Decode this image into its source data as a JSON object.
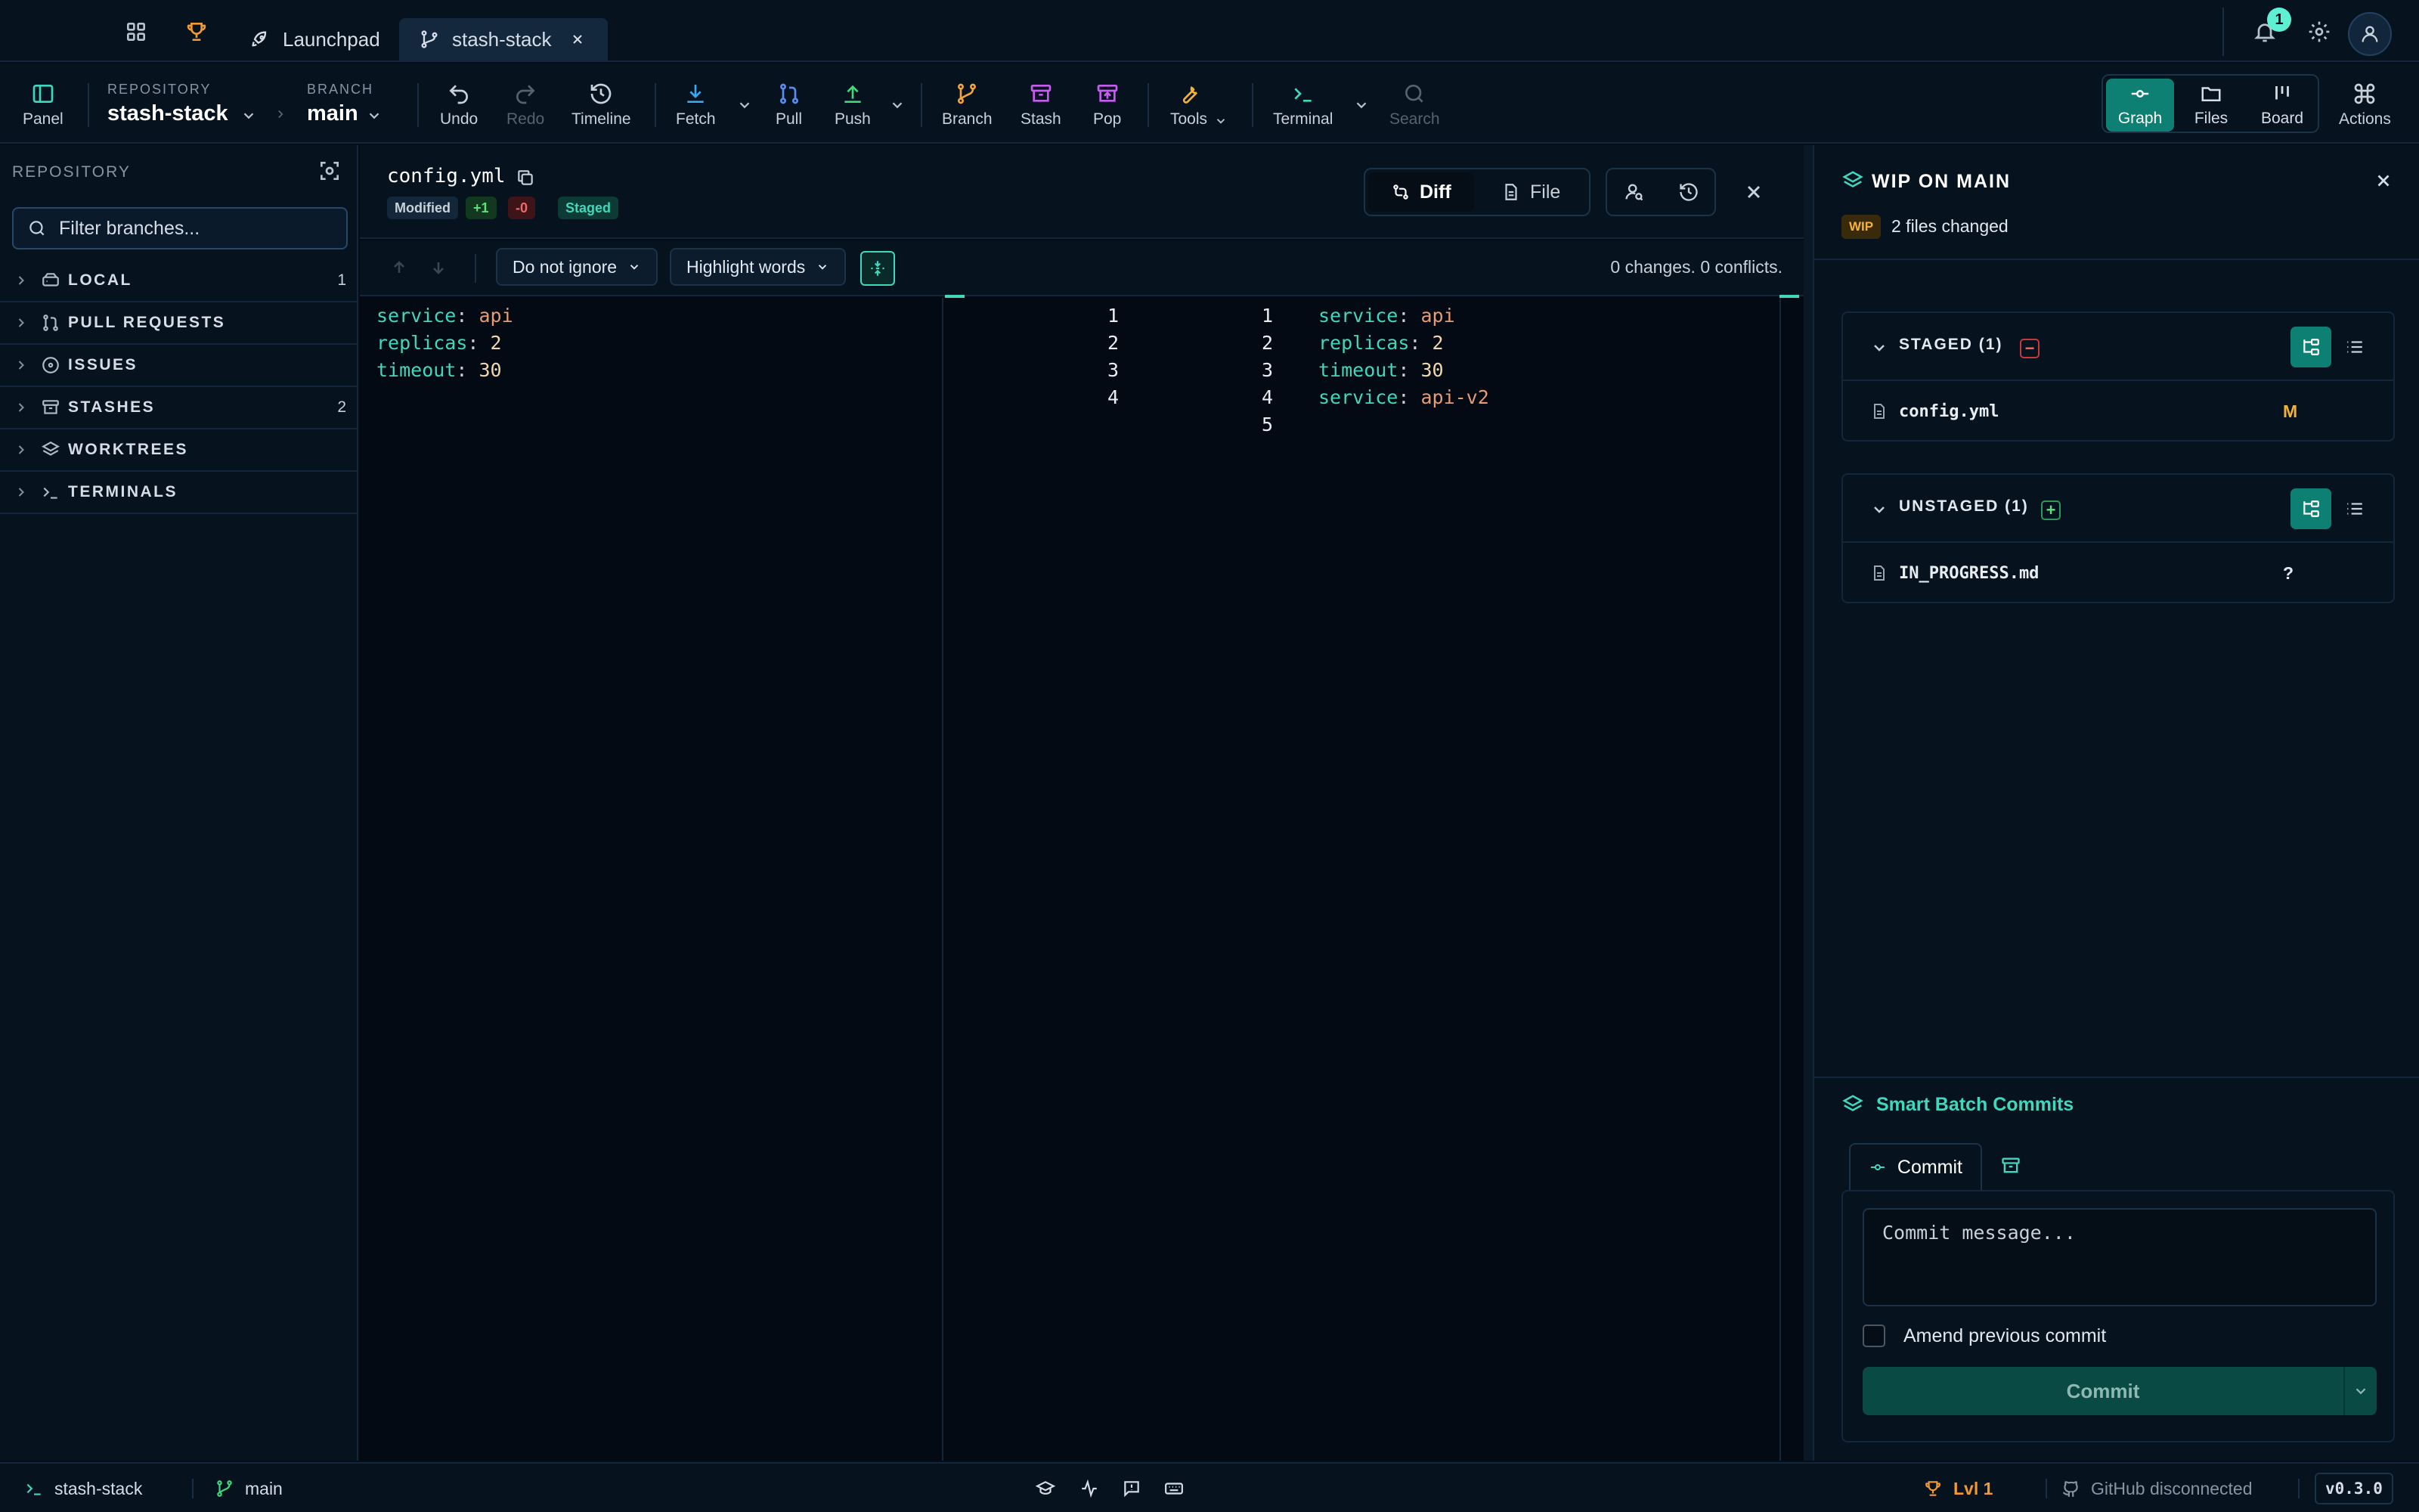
{
  "tabbar": {
    "tabs": [
      {
        "label": "Launchpad"
      },
      {
        "label": "stash-stack",
        "active": true
      }
    ],
    "notification_count": "1"
  },
  "toolbar": {
    "panel_label": "Panel",
    "repository_label": "REPOSITORY",
    "repository_value": "stash-stack",
    "branch_label": "BRANCH",
    "branch_value": "main",
    "undo": "Undo",
    "redo": "Redo",
    "timeline": "Timeline",
    "fetch": "Fetch",
    "pull": "Pull",
    "push": "Push",
    "branch": "Branch",
    "stash": "Stash",
    "pop": "Pop",
    "tools": "Tools",
    "terminal": "Terminal",
    "search": "Search",
    "views": {
      "graph": "Graph",
      "files": "Files",
      "board": "Board"
    },
    "actions": "Actions"
  },
  "sidebar": {
    "header": "REPOSITORY",
    "filter_placeholder": "Filter branches...",
    "items": [
      {
        "label": "LOCAL",
        "count": "1"
      },
      {
        "label": "PULL REQUESTS",
        "count": ""
      },
      {
        "label": "ISSUES",
        "count": ""
      },
      {
        "label": "STASHES",
        "count": "2"
      },
      {
        "label": "WORKTREES",
        "count": ""
      },
      {
        "label": "TERMINALS",
        "count": ""
      }
    ]
  },
  "diff": {
    "filename": "config.yml",
    "badges": {
      "modified": "Modified",
      "added": "+1",
      "removed": "-0",
      "staged": "Staged"
    },
    "view_diff": "Diff",
    "view_file": "File",
    "ignore_option": "Do not ignore",
    "highlight_option": "Highlight words",
    "status": "0 changes. 0 conflicts.",
    "left": [
      {
        "key": "service",
        "value": "api"
      },
      {
        "key": "replicas",
        "value": "2"
      },
      {
        "key": "timeout",
        "value": "30"
      }
    ],
    "left_line_numbers": [
      "1",
      "2",
      "3",
      "4"
    ],
    "right_line_numbers": [
      "1",
      "2",
      "3",
      "4",
      "5"
    ],
    "right": [
      {
        "key": "service",
        "value": "api"
      },
      {
        "key": "replicas",
        "value": "2"
      },
      {
        "key": "timeout",
        "value": "30"
      },
      {
        "key": "service",
        "value": "api-v2"
      }
    ]
  },
  "wip": {
    "title": "WIP ON MAIN",
    "pill": "WIP",
    "subtitle": "2 files changed",
    "staged": {
      "title": "STAGED (1)",
      "file": "config.yml",
      "status": "M"
    },
    "unstaged": {
      "title": "UNSTAGED (1)",
      "file": "IN_PROGRESS.md",
      "status": "?"
    },
    "smart_batch": "Smart Batch Commits",
    "commit_tab": "Commit",
    "commit_placeholder": "Commit message...",
    "amend_label": "Amend previous commit",
    "commit_button": "Commit"
  },
  "statusbar": {
    "terminal": "stash-stack",
    "branch": "main",
    "level": "Lvl 1",
    "github": "GitHub disconnected",
    "version": "v0.3.0"
  },
  "colors": {
    "accent": "#3fd8bd",
    "active_button": "#0e7f73",
    "modified": "#f2b23a"
  }
}
